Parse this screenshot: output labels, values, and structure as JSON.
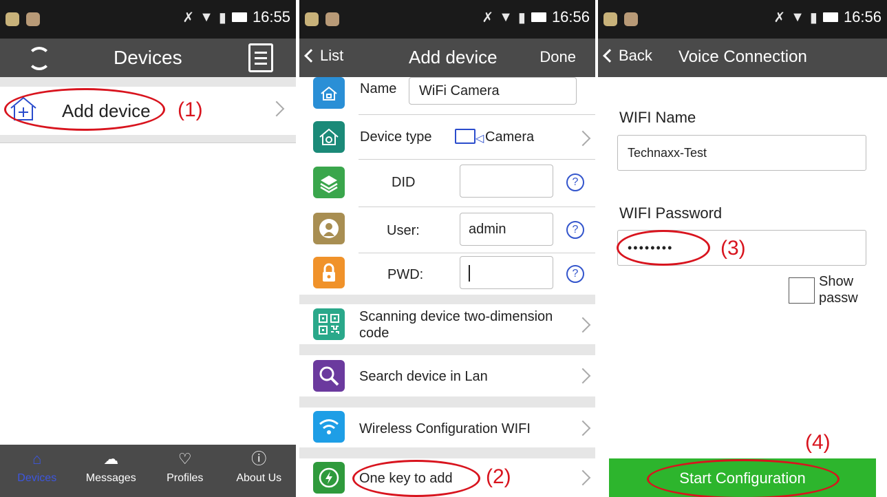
{
  "status_bars": [
    {
      "time": "16:55"
    },
    {
      "time": "16:56"
    },
    {
      "time": "16:56"
    }
  ],
  "devices_screen": {
    "title": "Devices",
    "add_device_label": "Add device",
    "annotation": "(1)",
    "tabs": [
      {
        "label": "Devices",
        "icon": "home-icon"
      },
      {
        "label": "Messages",
        "icon": "cloud-icon"
      },
      {
        "label": "Profiles",
        "icon": "heart-icon"
      },
      {
        "label": "About Us",
        "icon": "info-icon"
      }
    ],
    "active_tab": "Devices"
  },
  "add_device_screen": {
    "back_label": "List",
    "title": "Add device",
    "done_label": "Done",
    "name_label": "Name",
    "name_value": "WiFi Camera",
    "device_type_label": "Device type",
    "device_type_value": "Camera",
    "did_label": "DID",
    "did_value": "",
    "user_label": "User:",
    "user_value": "admin",
    "pwd_label": "PWD:",
    "pwd_value": "",
    "help_glyph": "?",
    "scan_label": "Scanning device two-dimension code",
    "search_label": "Search device in Lan",
    "wireless_label": "Wireless Configuration WIFI",
    "onekey_label": "One key to add",
    "annotation": "(2)",
    "colors": {
      "name_icon": "#2a8fd6",
      "device_type_icon": "#1b8a78",
      "did_icon": "#3aa64c",
      "user_icon": "#a88e52",
      "pwd_icon": "#f0922a",
      "scan_icon": "#2aa88a",
      "search_icon": "#6b3a9e",
      "wireless_icon": "#1e9ee6",
      "onekey_icon": "#2f9a3c"
    }
  },
  "voice_screen": {
    "back_label": "Back",
    "title": "Voice Connection",
    "wifi_name_label": "WIFI Name",
    "wifi_name_value": "Technaxx-Test",
    "wifi_password_label": "WIFI Password",
    "wifi_password_value": "••••••••",
    "annotation_3": "(3)",
    "show_label_line1": "Show",
    "show_label_line2": "passw",
    "annotation_4": "(4)",
    "start_button": "Start Configuration",
    "start_color": "#2db52d"
  }
}
